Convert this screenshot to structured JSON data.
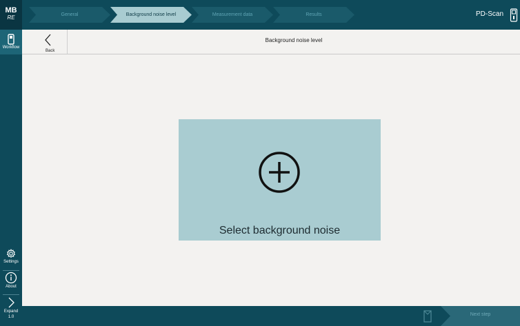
{
  "logo": {
    "line1": "MB",
    "line2": "RE"
  },
  "rail": {
    "workflow": "Workflow",
    "settings": "Settings",
    "about": "About",
    "expand": "Expand",
    "version": "1.0"
  },
  "steps": [
    {
      "label": "General",
      "state": "inactive"
    },
    {
      "label": "Background noise level",
      "state": "active"
    },
    {
      "label": "Measurement data",
      "state": "inactive"
    },
    {
      "label": "Results",
      "state": "inactive"
    }
  ],
  "app_name": "PD-Scan",
  "subheader": {
    "back_label": "Back",
    "title": "Background noise level"
  },
  "main": {
    "select_label": "Select background noise"
  },
  "bottom": {
    "next_label": "Next step"
  },
  "colors": {
    "rail": "#0e4a5a",
    "active_step": "#a9ccd1",
    "card": "#a9ccd1",
    "background": "#f3f2f0"
  },
  "icons": {
    "workflow": "device-icon",
    "settings": "gear-icon",
    "about": "info-icon",
    "expand": "chevron-right-icon",
    "back": "chevron-left-icon",
    "add": "plus-circle-icon",
    "device": "device-icon",
    "note": "document-icon"
  }
}
